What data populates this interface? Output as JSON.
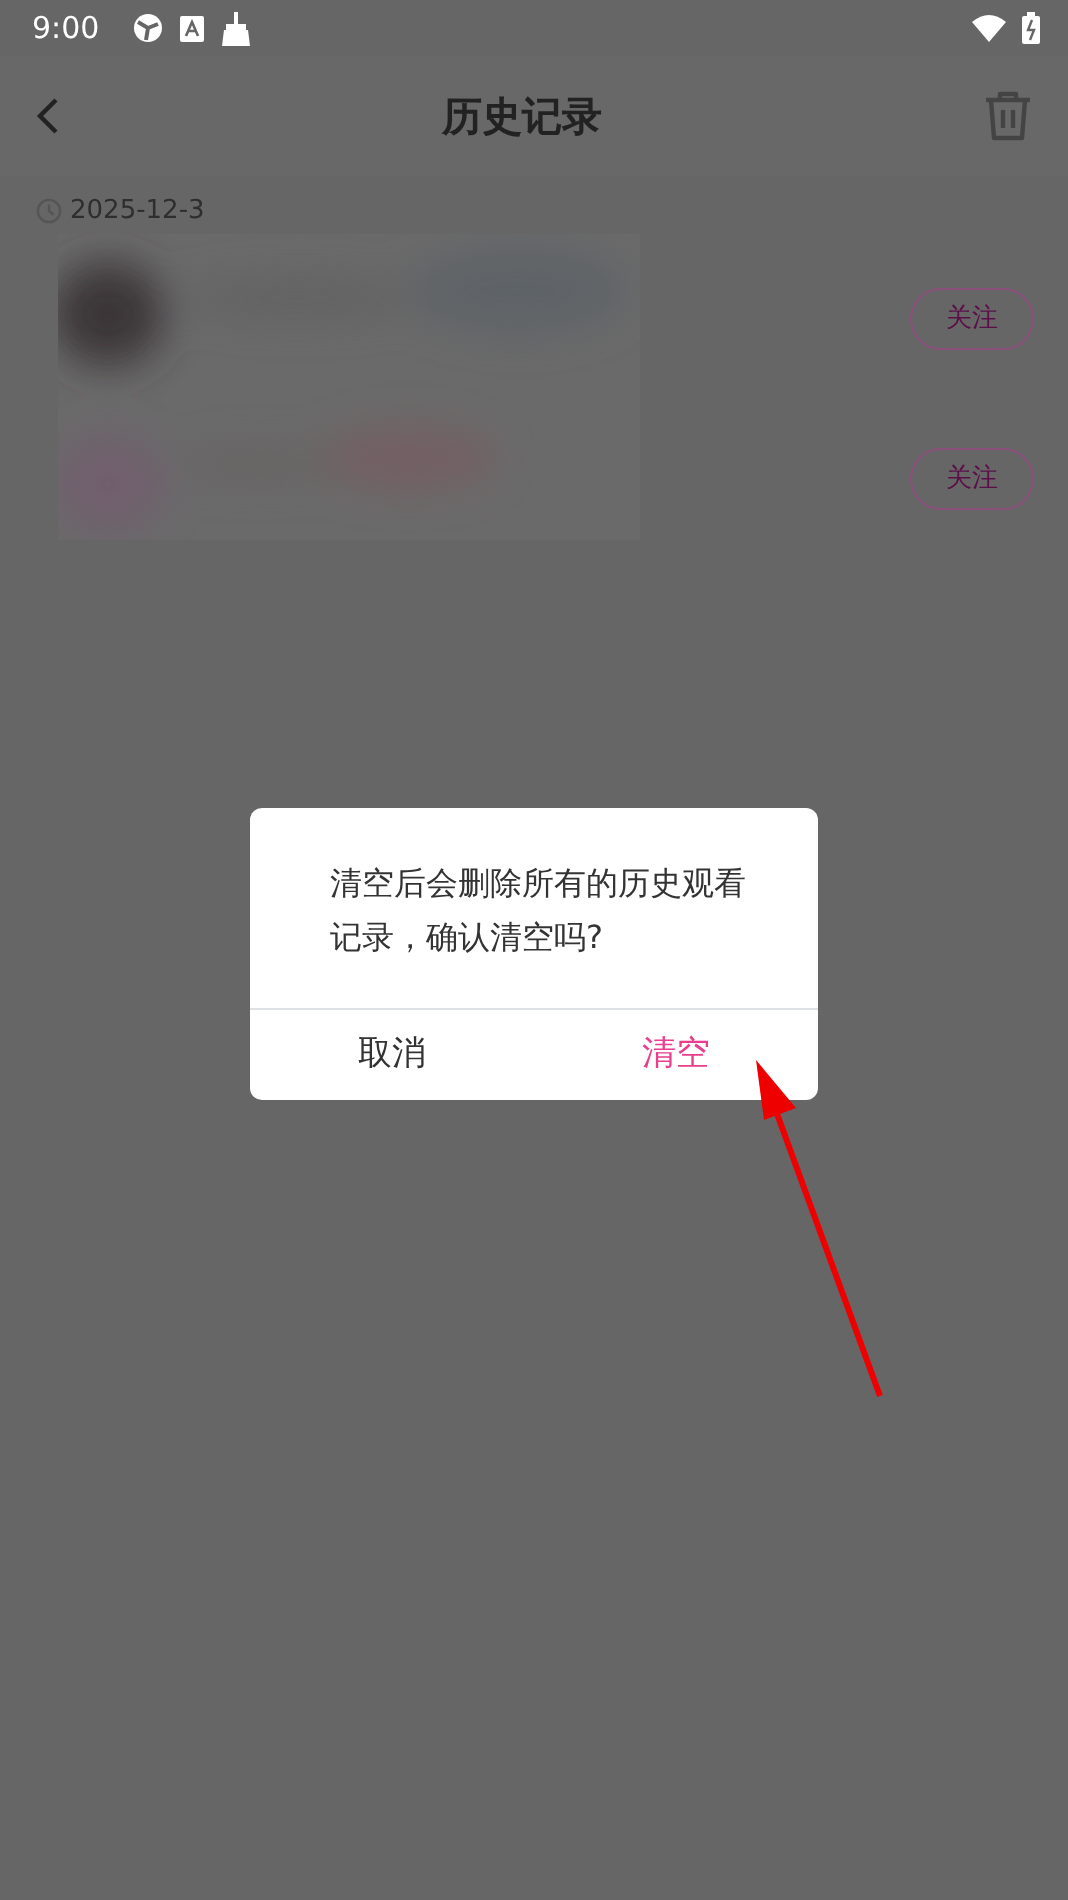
{
  "status_bar": {
    "time": "9:00"
  },
  "header": {
    "title": "历史记录"
  },
  "history": {
    "date": "2025-12-3",
    "items": [
      {
        "follow": "关注"
      },
      {
        "follow": "关注"
      }
    ]
  },
  "dialog": {
    "message": "清空后会删除所有的历史观看记录，确认清空吗?",
    "buttons": [
      {
        "label": "取消",
        "kind": "cancel"
      },
      {
        "label": "清空",
        "kind": "confirm"
      }
    ]
  }
}
